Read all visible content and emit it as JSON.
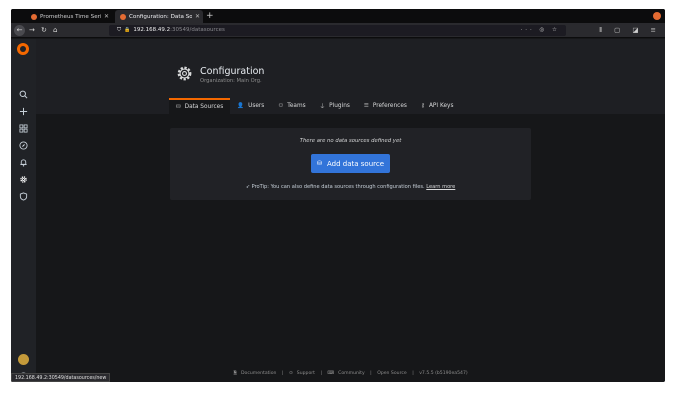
{
  "browser": {
    "tabs": [
      {
        "title": "Prometheus Time Series C"
      },
      {
        "title": "Configuration: Data Source"
      }
    ],
    "new_tab_glyph": "+",
    "url_host": "192.168.49.2",
    "url_path": ":30549/datasources",
    "status_url": "192.168.49.2:30549/datasources/new"
  },
  "page": {
    "title": "Configuration",
    "subtitle": "Organization: Main Org.",
    "tabs": [
      {
        "label": "Data Sources",
        "icon": "database-icon"
      },
      {
        "label": "Users",
        "icon": "user-icon"
      },
      {
        "label": "Teams",
        "icon": "users-icon"
      },
      {
        "label": "Plugins",
        "icon": "plug-icon"
      },
      {
        "label": "Preferences",
        "icon": "sliders-icon"
      },
      {
        "label": "API Keys",
        "icon": "key-icon"
      }
    ],
    "active_tab": "Data Sources"
  },
  "empty_state": {
    "message": "There are no data sources defined yet",
    "button_label": "Add data source",
    "protip_text": "ProTip: You can also define data sources through configuration files.",
    "learn_more": "Learn more"
  },
  "footer": {
    "documentation": "Documentation",
    "support": "Support",
    "community": "Community",
    "open_source": "Open Source",
    "version": "v7.5.5 (b5190ea547)"
  },
  "colors": {
    "accent": "#f46800",
    "primary_button": "#3274d9",
    "background": "#161719"
  }
}
